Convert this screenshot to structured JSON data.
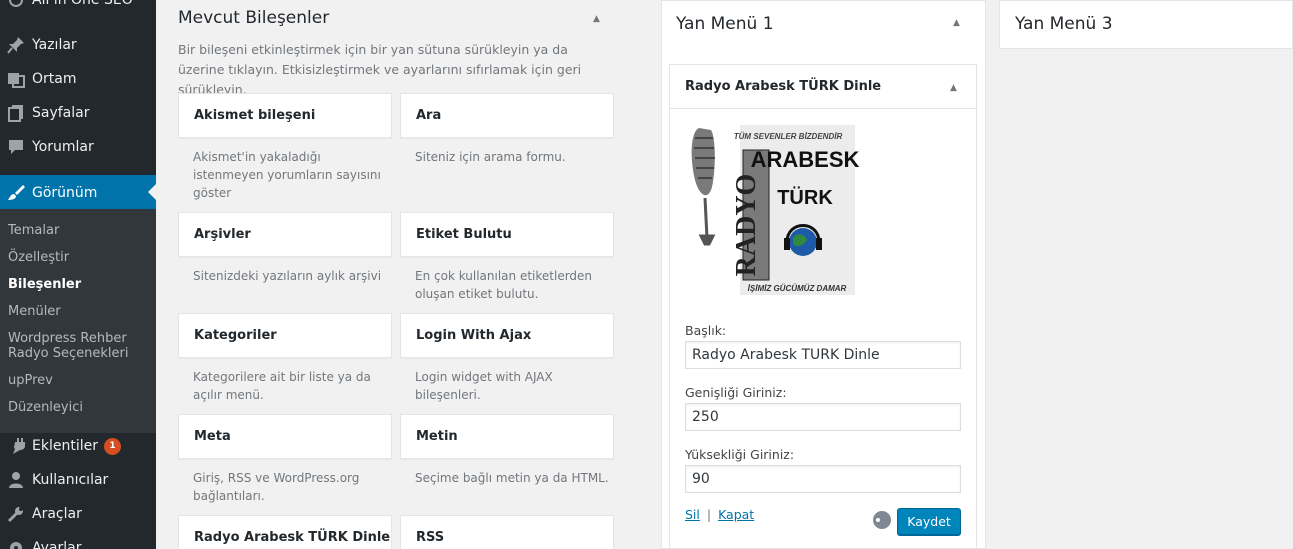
{
  "sidebar": {
    "top_item": "All in One SEO",
    "items": [
      {
        "label": "Yazılar",
        "icon": "pin-icon"
      },
      {
        "label": "Ortam",
        "icon": "media-icon"
      },
      {
        "label": "Sayfalar",
        "icon": "pages-icon"
      },
      {
        "label": "Yorumlar",
        "icon": "comments-icon"
      },
      {
        "label": "Görünüm",
        "icon": "paintbrush-icon"
      }
    ],
    "submenu": [
      "Temalar",
      "Özelleştir",
      "Bileşenler",
      "Menüler",
      "Wordpress Rehber Radyo Seçenekleri",
      "upPrev",
      "Düzenleyici"
    ],
    "submenu_active": "Bileşenler",
    "lower_items": [
      {
        "label": "Eklentiler",
        "icon": "plugins-icon",
        "badge": "1"
      },
      {
        "label": "Kullanıcılar",
        "icon": "users-icon"
      },
      {
        "label": "Araçlar",
        "icon": "tools-icon"
      },
      {
        "label": "Ayarlar",
        "icon": "settings-icon"
      }
    ]
  },
  "available": {
    "title": "Mevcut Bileşenler",
    "description": "Bir bileşeni etkinleştirmek için bir yan sütuna sürükleyin ya da üzerine tıklayın. Etkisizleştirmek ve ayarlarını sıfırlamak için geri sürükleyin.",
    "widgets": [
      {
        "name": "Akismet bileşeni",
        "desc": "Akismet'in yakaladığı istenmeyen yorumların sayısını göster"
      },
      {
        "name": "Ara",
        "desc": "Siteniz için arama formu."
      },
      {
        "name": "Arşivler",
        "desc": "Sitenizdeki yazıların aylık arşivi"
      },
      {
        "name": "Etiket Bulutu",
        "desc": "En çok kullanılan etiketlerden oluşan etiket bulutu."
      },
      {
        "name": "Kategoriler",
        "desc": "Kategorilere ait bir liste ya da açılır menü."
      },
      {
        "name": "Login With Ajax",
        "desc": "Login widget with AJAX bileşenleri."
      },
      {
        "name": "Meta",
        "desc": "Giriş, RSS ve WordPress.org bağlantıları."
      },
      {
        "name": "Metin",
        "desc": "Seçime bağlı metin ya da HTML."
      },
      {
        "name": "Radyo Arabesk TÜRK Dinle",
        "desc": ""
      },
      {
        "name": "RSS",
        "desc": ""
      }
    ]
  },
  "areas": {
    "side1": {
      "title": "Yan Menü 1"
    },
    "side3": {
      "title": "Yan Menü 3"
    }
  },
  "open_widget": {
    "title": "Radyo Arabesk TÜRK Dinle",
    "logo": {
      "top": "TÜM SEVENLER BİZDENDİR",
      "main": "ARABESK",
      "side": "RADYO",
      "turk": "TÜRK",
      "bottom": "İŞİMİZ GÜCÜMÜZ DAMAR"
    },
    "fields": [
      {
        "label": "Başlık:",
        "value": "Radyo Arabesk TÜRK Dinle"
      },
      {
        "label": "Genişliği Giriniz:",
        "value": "250"
      },
      {
        "label": "Yüksekliği Giriniz:",
        "value": "90"
      }
    ],
    "delete_label": "Sil",
    "separator": "|",
    "close_label": "Kapat",
    "save_label": "Kaydet"
  },
  "colors": {
    "accent": "#0073aa",
    "sidebar_bg": "#23282d",
    "button": "#0085ba",
    "badge": "#d54e21"
  }
}
